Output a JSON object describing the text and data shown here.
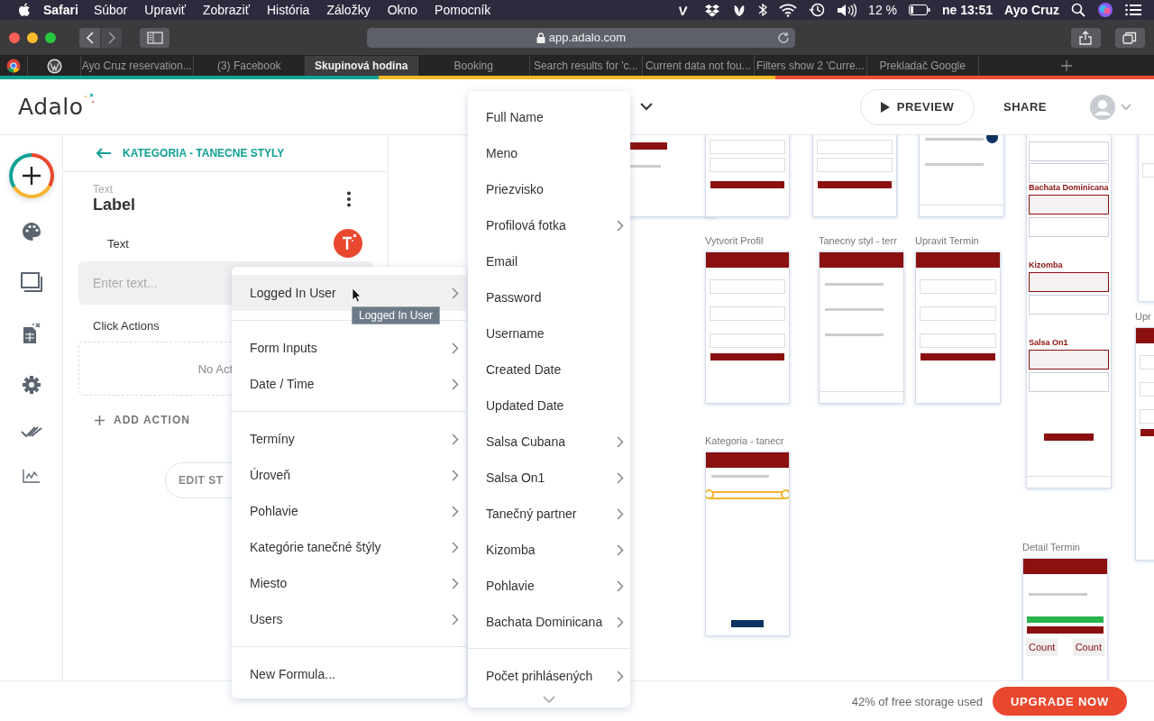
{
  "menubar": {
    "app": "Safari",
    "items": [
      "Súbor",
      "Upraviť",
      "Zobraziť",
      "História",
      "Záložky",
      "Okno",
      "Pomocník"
    ],
    "battery": "12 %",
    "clock": "ne 13:51",
    "user": "Ayo Cruz"
  },
  "browser": {
    "url": "app.adalo.com",
    "tabs": [
      {
        "label": "Ayo Cruz reservation...",
        "selected": false
      },
      {
        "label": "(3) Facebook",
        "selected": false
      },
      {
        "label": "Skupinová hodina",
        "selected": true
      },
      {
        "label": "Booking",
        "selected": false
      },
      {
        "label": "Search results for 'c...",
        "selected": false
      },
      {
        "label": "Current data not fou...",
        "selected": false
      },
      {
        "label": "Filters show 2 'Curre...",
        "selected": false
      },
      {
        "label": "Prekladač Google",
        "selected": false
      }
    ]
  },
  "header": {
    "logo": "Adalo",
    "preview": "PREVIEW",
    "share": "SHARE"
  },
  "panel": {
    "back": "KATEGORIA - TANECNE STYLY",
    "component_type": "Text",
    "component_name": "Label",
    "text_label": "Text",
    "placeholder": "Enter text...",
    "click_actions": "Click Actions",
    "no_actions": "No Act",
    "add_action": "ADD ACTION",
    "edit_styles": "EDIT ST"
  },
  "menu": {
    "tooltip": "Logged In User",
    "groups": [
      [
        {
          "label": "Logged In User",
          "submenu": true,
          "selected": true
        }
      ],
      [
        {
          "label": "Form Inputs",
          "submenu": true,
          "selected": false
        },
        {
          "label": "Date / Time",
          "submenu": true,
          "selected": false
        }
      ],
      [
        {
          "label": "Termíny",
          "submenu": true,
          "selected": false
        },
        {
          "label": "Úroveň",
          "submenu": true,
          "selected": false
        },
        {
          "label": "Pohlavie",
          "submenu": true,
          "selected": false
        },
        {
          "label": "Kategórie tanečné štýly",
          "submenu": true,
          "selected": false
        },
        {
          "label": "Miesto",
          "submenu": true,
          "selected": false
        },
        {
          "label": "Users",
          "submenu": true,
          "selected": false
        }
      ],
      [
        {
          "label": "New Formula...",
          "submenu": false,
          "selected": false
        }
      ]
    ]
  },
  "submenu": {
    "items": [
      {
        "label": "Full Name",
        "submenu": false
      },
      {
        "label": "Meno",
        "submenu": false
      },
      {
        "label": "Priezvisko",
        "submenu": false
      },
      {
        "label": "Profilová fotka",
        "submenu": true
      },
      {
        "label": "Email",
        "submenu": false
      },
      {
        "label": "Password",
        "submenu": false
      },
      {
        "label": "Username",
        "submenu": false
      },
      {
        "label": "Created Date",
        "submenu": false
      },
      {
        "label": "Updated Date",
        "submenu": false
      },
      {
        "label": "Salsa Cubana",
        "submenu": true
      },
      {
        "label": "Salsa On1",
        "submenu": true
      },
      {
        "label": "Tanečný partner",
        "submenu": true
      },
      {
        "label": "Kizomba",
        "submenu": true
      },
      {
        "label": "Pohlavie",
        "submenu": true
      },
      {
        "label": "Bachata Dominicana",
        "submenu": true
      }
    ],
    "footer": [
      {
        "label": "Počet prihlásených",
        "submenu": true
      }
    ]
  },
  "canvas": {
    "screens": [
      {
        "kind": "menu"
      },
      {
        "kind": "form"
      },
      {
        "kind": "form"
      },
      {
        "kind": "tabs"
      },
      {
        "title": "Vytvorit Profil",
        "kind": "form"
      },
      {
        "title": "Tanecny styl - terr",
        "kind": "tabs"
      },
      {
        "title": "Upravit Termin",
        "kind": "form"
      },
      {
        "kind": "categories",
        "headings": [
          "Bachata Dominicana",
          "Kizomba",
          "Salsa On1"
        ]
      },
      {
        "kind": "plain"
      },
      {
        "title": "Upr",
        "kind": "form"
      },
      {
        "title": "Kategoria - tanecr",
        "kind": "selection"
      },
      {
        "title": "Detail Termin",
        "kind": "detail",
        "counts": [
          "Count",
          "Count"
        ]
      }
    ]
  },
  "footer": {
    "storage": "42% of free storage used",
    "upgrade": "UPGRADE NOW"
  }
}
